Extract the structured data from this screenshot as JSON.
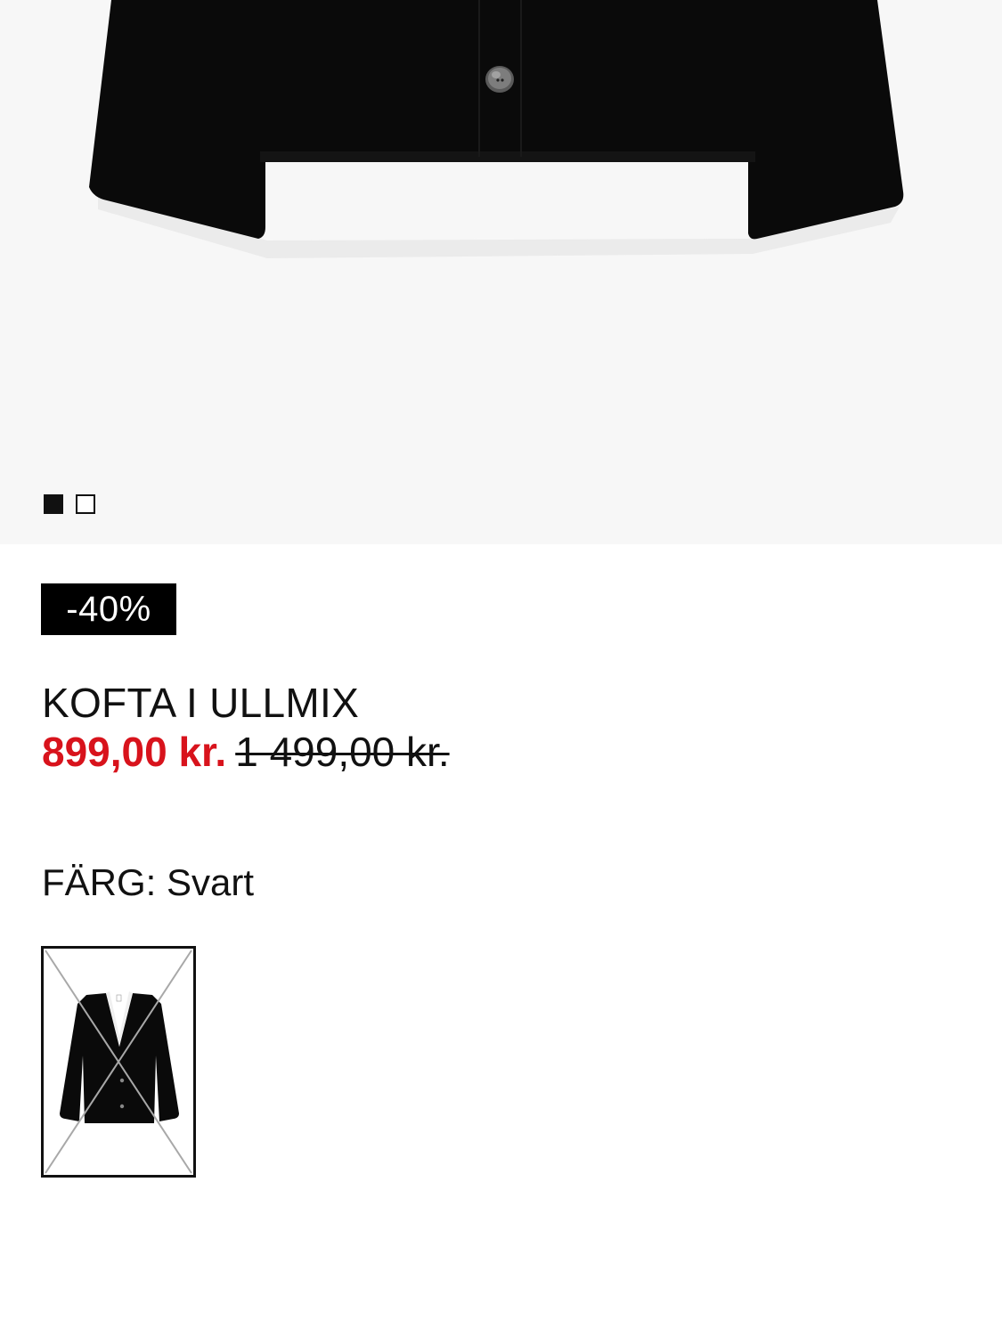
{
  "gallery": {
    "image_alt": "Svart kofta i ullmix",
    "dots": [
      {
        "active": true
      },
      {
        "active": false
      }
    ]
  },
  "product": {
    "discount_badge": "-40%",
    "title": "KOFTA I ULLMIX",
    "price_current": "899,00 kr.",
    "price_original": "1 499,00 kr."
  },
  "color": {
    "label": "FÄRG: Svart",
    "swatches": [
      {
        "name": "Svart",
        "available": false,
        "selected": true
      }
    ]
  },
  "colors": {
    "sale_red": "#d8131c",
    "garment": "#0a0a0a",
    "hero_bg": "#f7f7f7"
  }
}
